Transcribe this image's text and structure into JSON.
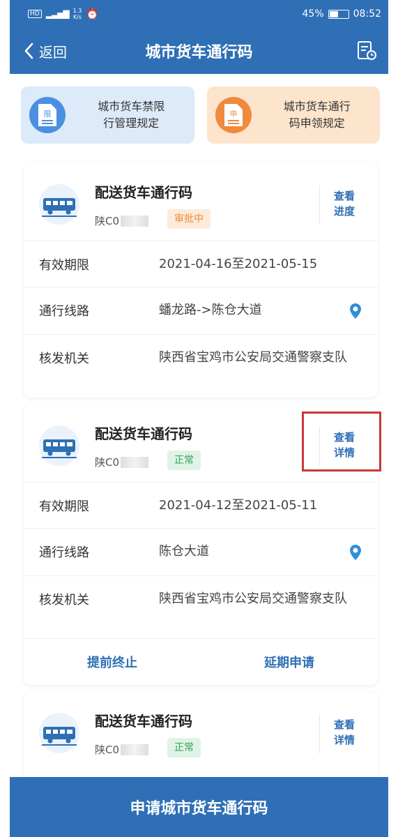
{
  "status_bar": {
    "signal_top": "1.3",
    "signal_unit": "K/s",
    "battery": "45%",
    "time": "08:52"
  },
  "nav": {
    "back_label": "返回",
    "title": "城市货车通行码"
  },
  "quick_links": [
    {
      "icon_char": "限",
      "line1": "城市货车禁限",
      "line2": "行管理规定",
      "color": "#4a90e2"
    },
    {
      "icon_char": "申",
      "line1": "城市货车通行",
      "line2": "码申领规定",
      "color": "#f08a3c"
    }
  ],
  "cards": [
    {
      "title": "配送货车通行码",
      "plate": "陕C0",
      "status": "审批中",
      "side_line1": "查看",
      "side_line2": "进度",
      "validity_label": "有效期限",
      "validity": "2021-04-16至2021-05-15",
      "route_label": "通行线路",
      "route": "蟠龙路->陈仓大道",
      "issuer_label": "核发机关",
      "issuer": "陕西省宝鸡市公安局交通警察支队"
    },
    {
      "title": "配送货车通行码",
      "plate": "陕C0",
      "status": "正常",
      "side_line1": "查看",
      "side_line2": "详情",
      "validity_label": "有效期限",
      "validity": "2021-04-12至2021-05-11",
      "route_label": "通行线路",
      "route": "陈仓大道",
      "issuer_label": "核发机关",
      "issuer": "陕西省宝鸡市公安局交通警察支队",
      "action_left": "提前终止",
      "action_right": "延期申请"
    },
    {
      "title": "配送货车通行码",
      "plate": "陕C0",
      "status": "正常",
      "side_line1": "查看",
      "side_line2": "详情"
    }
  ],
  "footer": {
    "apply_label": "申请城市货车通行码"
  },
  "colors": {
    "primary": "#2f6fb5",
    "pending": "#f08a3c",
    "normal": "#2fa35c",
    "highlight": "#c9383a"
  }
}
